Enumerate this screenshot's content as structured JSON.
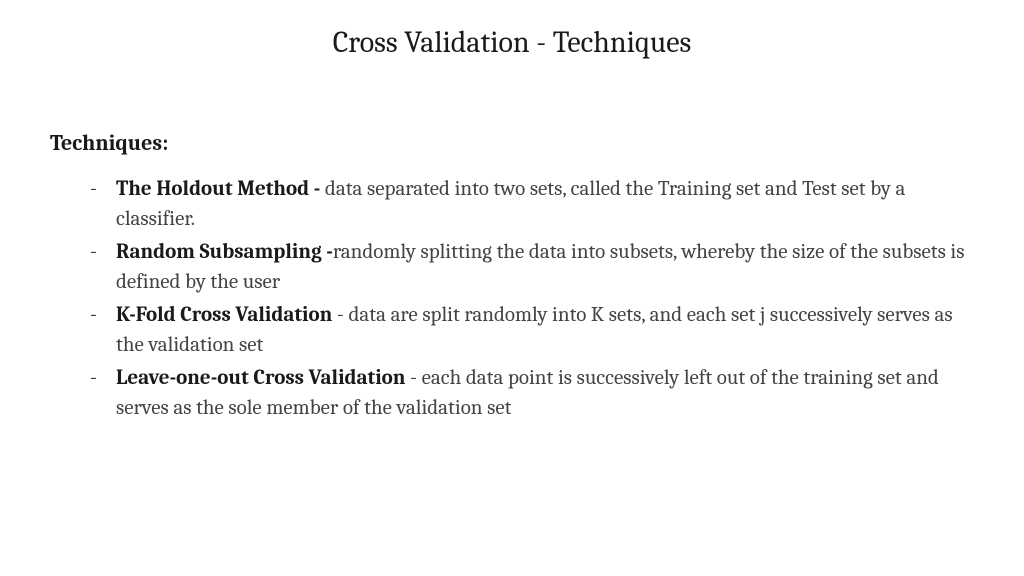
{
  "title": "Cross Validation - Techniques",
  "section_heading": "Techniques:",
  "items": [
    {
      "name": "The Holdout Method - ",
      "desc": "data separated into two sets, called the Training set and Test set by a classifier."
    },
    {
      "name": "Random Subsampling -",
      "desc": "randomly splitting the data into subsets, whereby the size of the subsets is defined by the user"
    },
    {
      "name": "K-Fold Cross Validation",
      "desc": " -  data are split randomly into K sets, and each set j successively serves as the validation set"
    },
    {
      "name": "Leave-one-out Cross Validation",
      "desc": " - each data point is successively left out of the training set and serves as the sole member of the validation set"
    }
  ]
}
